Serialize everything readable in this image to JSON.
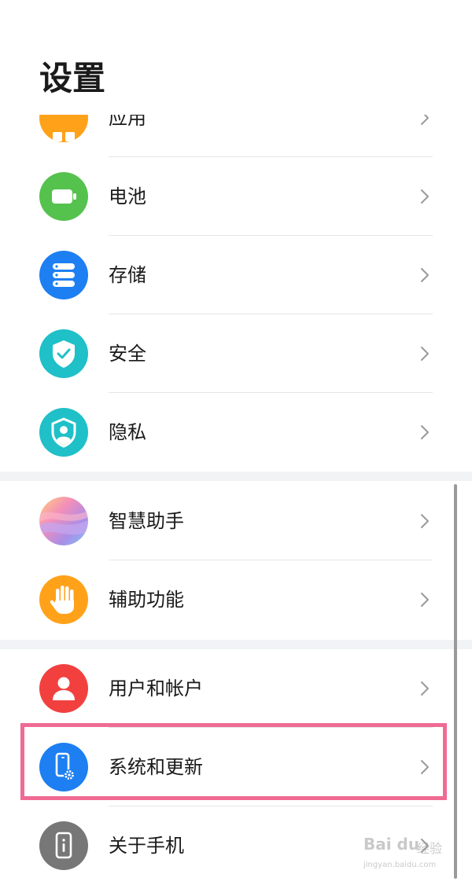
{
  "header": {
    "title": "设置"
  },
  "groups": [
    {
      "items": [
        {
          "label": "应用",
          "icon": "apps-icon",
          "color": "#ffa21a"
        },
        {
          "label": "电池",
          "icon": "battery-icon",
          "color": "#55c24e"
        },
        {
          "label": "存储",
          "icon": "storage-icon",
          "color": "#1d7ff2"
        },
        {
          "label": "安全",
          "icon": "shield-check-icon",
          "color": "#1fc0c8"
        },
        {
          "label": "隐私",
          "icon": "privacy-shield-icon",
          "color": "#1fc0c8"
        }
      ]
    },
    {
      "items": [
        {
          "label": "智慧助手",
          "icon": "smart-assistant-icon",
          "color": "#b69ee6"
        },
        {
          "label": "辅助功能",
          "icon": "hand-icon",
          "color": "#ffa21a"
        }
      ]
    },
    {
      "items": [
        {
          "label": "用户和帐户",
          "icon": "user-icon",
          "color": "#f2403f"
        },
        {
          "label": "系统和更新",
          "icon": "phone-gear-icon",
          "color": "#1d7ff2",
          "highlighted": true
        },
        {
          "label": "关于手机",
          "icon": "phone-info-icon",
          "color": "#777777"
        }
      ]
    }
  ],
  "highlight_color": "#ef6b93",
  "watermark": {
    "logo": "Bai du",
    "brand": "经验",
    "domain": "jingyan.baidu.com"
  }
}
